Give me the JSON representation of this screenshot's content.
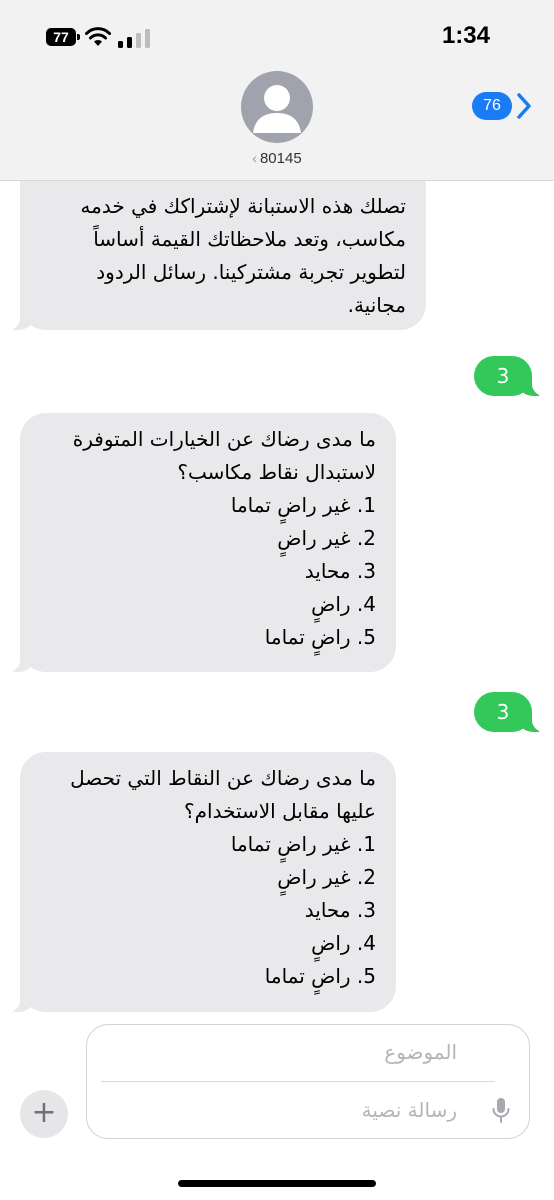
{
  "status_bar": {
    "time": "1:34",
    "battery": "77"
  },
  "header": {
    "contact": "80145",
    "back_count": "76"
  },
  "messages": [
    {
      "direction": "incoming",
      "lines": [
        "تصلك هذه الاستبانة لإشتراكك في خدمه",
        "مكاسب، وتعد ملاحظاتك القيمة أساساً",
        "لتطوير تجربة مشتركينا. رسائل الردود",
        "مجانية."
      ]
    },
    {
      "direction": "outgoing",
      "text": "3"
    },
    {
      "direction": "incoming",
      "lines": [
        "ما مدى رضاك عن الخيارات المتوفرة",
        "لاستبدال نقاط مكاسب؟",
        "1. غير راضٍ تماما",
        "2. غير راضٍ",
        "3. محايد",
        "4. راضٍ",
        "5. راضٍ تماما"
      ]
    },
    {
      "direction": "outgoing",
      "text": "3"
    },
    {
      "direction": "incoming",
      "lines": [
        "ما مدى رضاك عن النقاط التي تحصل",
        "عليها مقابل الاستخدام؟",
        "1. غير راضٍ تماما",
        "2. غير راضٍ",
        "3. محايد",
        "4. راضٍ",
        "5. راضٍ تماما"
      ]
    }
  ],
  "composer": {
    "subject_placeholder": "الموضوع",
    "message_placeholder": "رسالة نصية",
    "plus_label": "+"
  },
  "colors": {
    "incoming_bubble": "#e9e9eb",
    "outgoing_bubble": "#34c759",
    "accent": "#1a7cf5"
  }
}
